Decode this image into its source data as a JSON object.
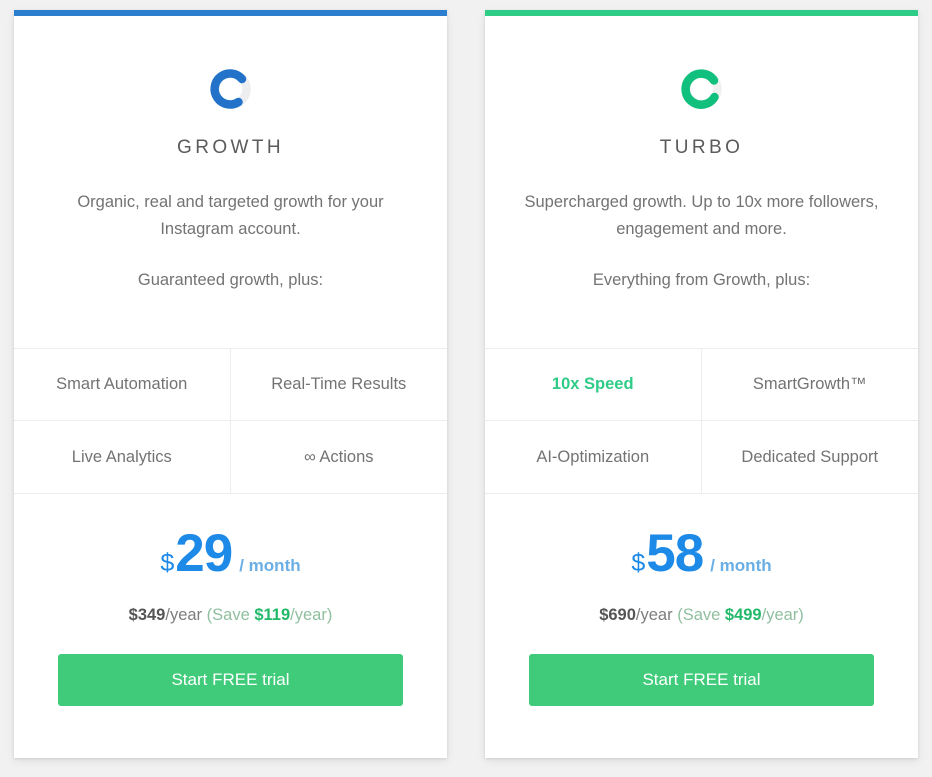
{
  "page": {
    "background_color": "#f1f1f1"
  },
  "plans": [
    {
      "accent_color": "#2b7fce",
      "logo_icon": "circular-loader-icon",
      "name": "GROWTH",
      "description": "Organic, real and targeted growth for your Instagram account.",
      "tagline": "Guaranteed growth, plus:",
      "features": [
        {
          "label": "Smart Automation",
          "highlight": false
        },
        {
          "label": "Real-Time Results",
          "highlight": false
        },
        {
          "label": "Live Analytics",
          "highlight": false
        },
        {
          "label": "∞ Actions",
          "highlight": false
        }
      ],
      "price": {
        "currency": "$",
        "amount": "29",
        "period": "/ month",
        "yearly_price": "$349",
        "yearly_suffix": "/year",
        "save_prefix": "(Save ",
        "save_amount": "$119",
        "save_suffix": "/year)"
      },
      "cta_label": "Start FREE trial"
    },
    {
      "accent_color": "#2ecc87",
      "logo_icon": "circular-loader-icon",
      "name": "TURBO",
      "description": "Supercharged growth. Up to 10x more followers, engagement and more.",
      "tagline": "Everything from Growth, plus:",
      "features": [
        {
          "label": "10x Speed",
          "highlight": true
        },
        {
          "label": "SmartGrowth™",
          "highlight": false
        },
        {
          "label": "AI-Optimization",
          "highlight": false
        },
        {
          "label": "Dedicated Support",
          "highlight": false
        }
      ],
      "price": {
        "currency": "$",
        "amount": "58",
        "period": "/ month",
        "yearly_price": "$690",
        "yearly_suffix": "/year",
        "save_prefix": "(Save ",
        "save_amount": "$499",
        "save_suffix": "/year)"
      },
      "cta_label": "Start FREE trial"
    }
  ],
  "colors": {
    "price_blue": "#1d8ae8",
    "period_blue": "#6aaee6",
    "cta_green": "#3fcb7a",
    "save_green": "#23b96a",
    "highlight_green": "#2ecc87",
    "text_gray": "#737373"
  }
}
